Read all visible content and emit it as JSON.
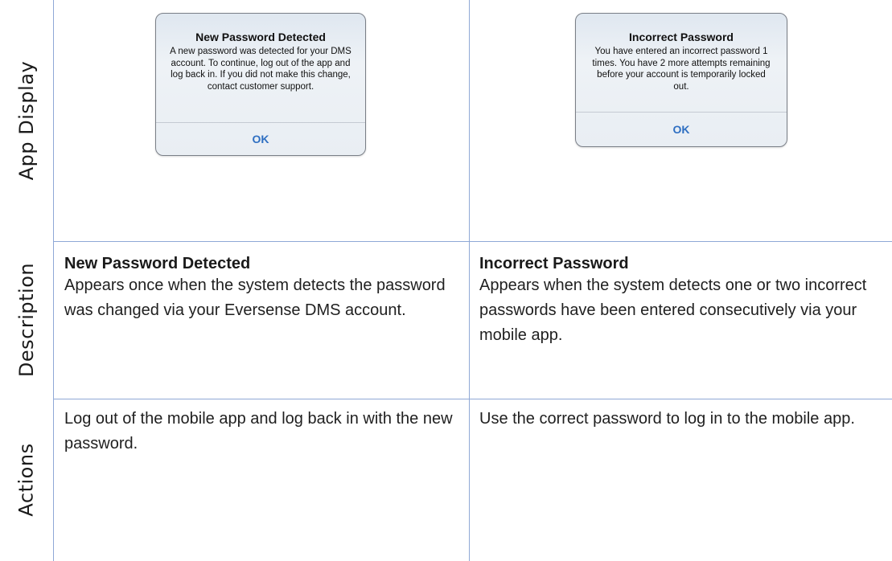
{
  "rows": {
    "app_display": "App Display",
    "description": "Description",
    "actions": "Actions"
  },
  "left": {
    "alert": {
      "title": "New Password Detected",
      "message": "A new password was detected for your DMS account. To continue, log out of the app and log back in. If you did not make this change, contact customer support.",
      "button": "OK"
    },
    "description_title": "New Password Detected",
    "description_text": "Appears once when the system detects the password was changed via your Eversense DMS account.",
    "actions_text": "Log out of the mobile app and log back in with the new password."
  },
  "right": {
    "alert": {
      "title": "Incorrect Password",
      "message": "You have entered an incorrect password 1 times. You have 2 more attempts remaining before your account is temporarily locked out.",
      "button": "OK"
    },
    "description_title": "Incorrect Password",
    "description_text": "Appears when the system detects one or two incorrect passwords have been entered consecutively via your mobile app.",
    "actions_text": "Use the correct password to log in to the mobile app."
  },
  "colors": {
    "grid_line": "#8fa8d6",
    "ok_button": "#2f6fc2"
  }
}
